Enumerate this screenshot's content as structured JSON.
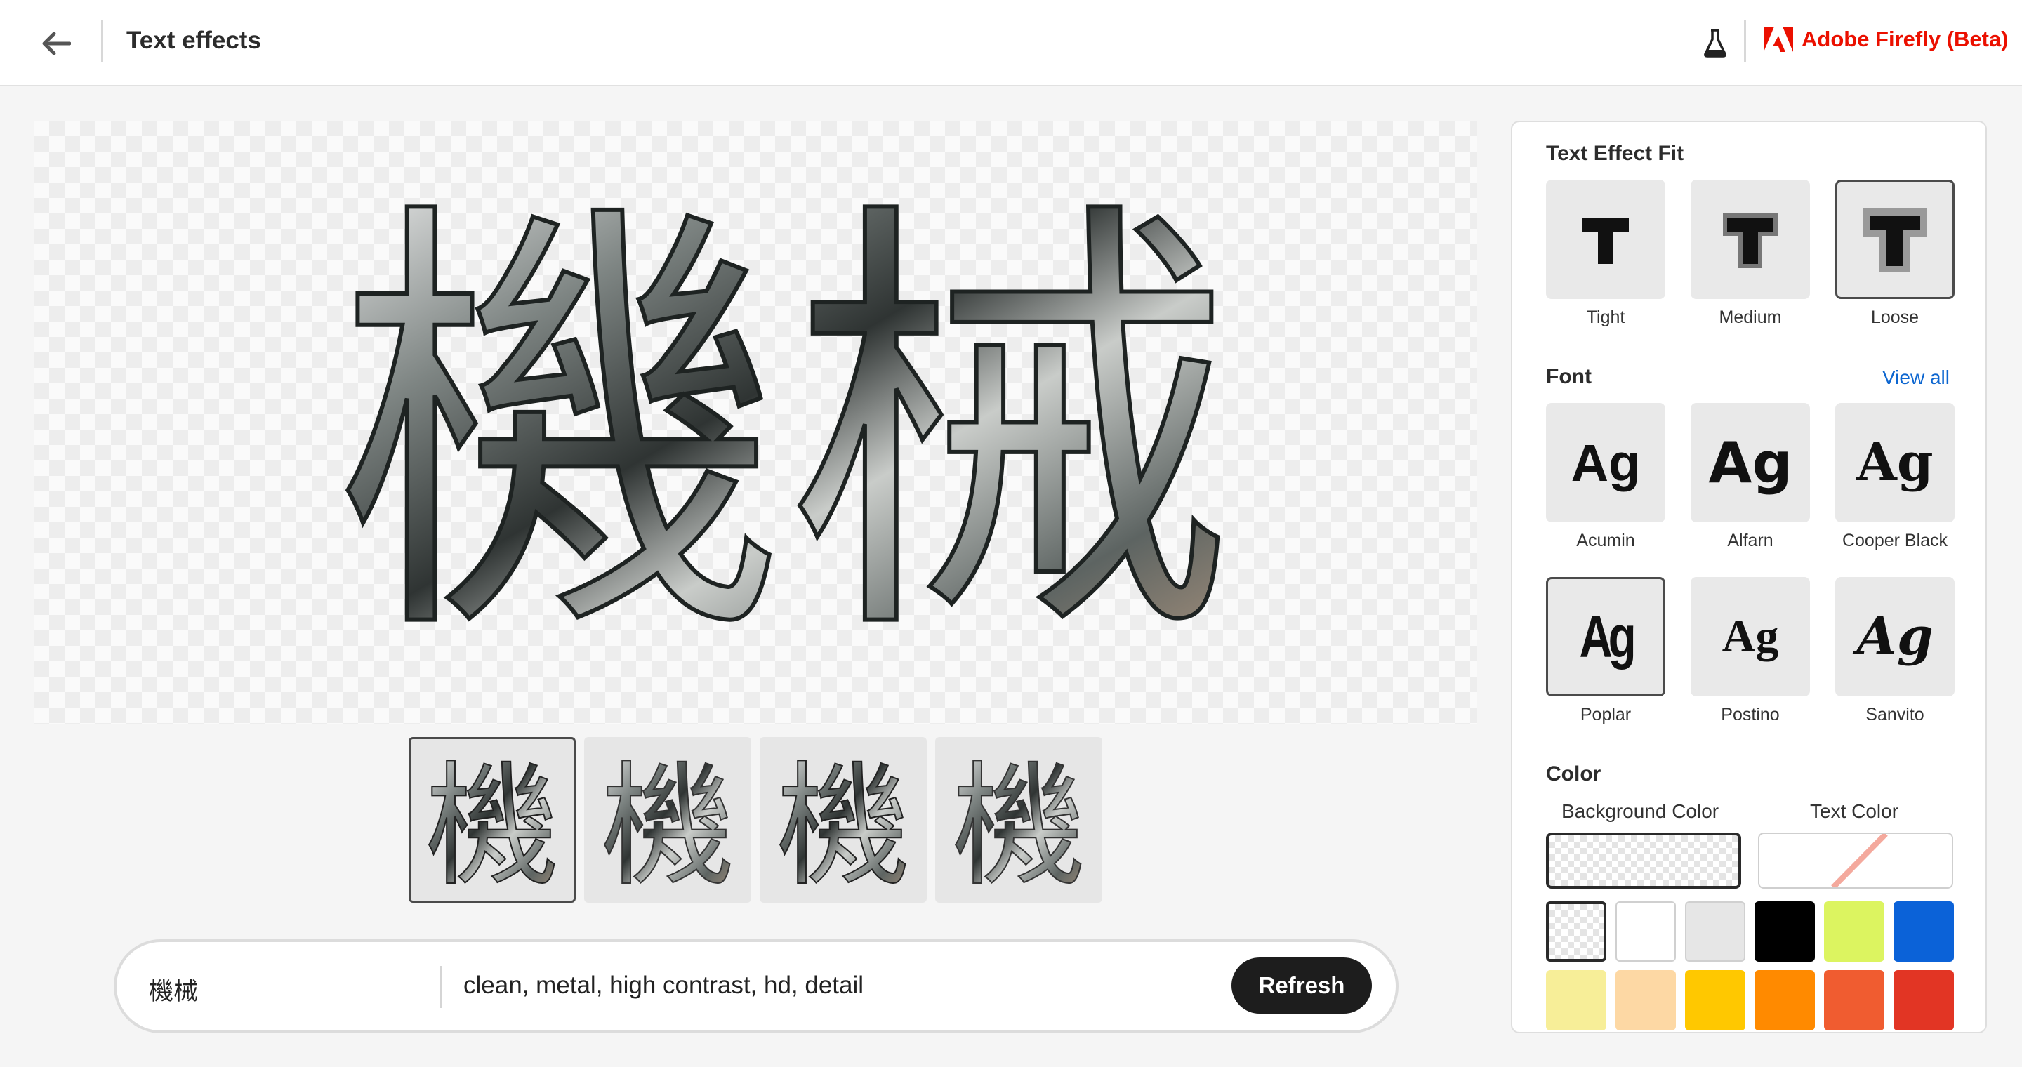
{
  "header": {
    "back_icon": "arrow-left-icon",
    "title": "Text effects",
    "lab_icon": "flask-icon",
    "brand_name": "Adobe Firefly (Beta)",
    "brand_color": "#eb1000"
  },
  "canvas": {
    "main_text": "機械",
    "thumbnails": [
      {
        "text": "機",
        "selected": true
      },
      {
        "text": "機",
        "selected": false
      },
      {
        "text": "機",
        "selected": false
      },
      {
        "text": "機",
        "selected": false
      }
    ]
  },
  "prompt": {
    "text": "機械",
    "description": "clean, metal, high contrast, hd, detail",
    "refresh_label": "Refresh"
  },
  "panel": {
    "fit": {
      "title": "Text Effect Fit",
      "options": [
        {
          "label": "Tight",
          "selected": false
        },
        {
          "label": "Medium",
          "selected": false
        },
        {
          "label": "Loose",
          "selected": true
        }
      ]
    },
    "font": {
      "title": "Font",
      "view_all": "View all",
      "sample": "Ag",
      "options": [
        {
          "label": "Acumin",
          "selected": false
        },
        {
          "label": "Alfarn",
          "selected": false
        },
        {
          "label": "Cooper Black",
          "selected": false
        },
        {
          "label": "Poplar",
          "selected": true
        },
        {
          "label": "Postino",
          "selected": false
        },
        {
          "label": "Sanvito",
          "selected": false
        }
      ]
    },
    "color": {
      "title": "Color",
      "background_label": "Background Color",
      "text_label": "Text Color",
      "swatches": [
        "transparent",
        "#ffffff",
        "#e6e6e6",
        "#000000",
        "#dcf460",
        "#0b62d8",
        "#f7ee98",
        "#fdd8a4",
        "#ffc800",
        "#ff8a00",
        "#f05c30",
        "#e23524"
      ]
    }
  }
}
